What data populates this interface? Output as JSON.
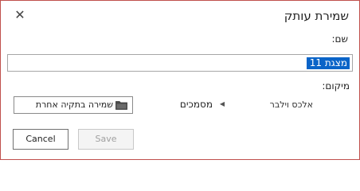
{
  "dialog": {
    "title": "שמירת עותק",
    "close_icon": "close-icon"
  },
  "name": {
    "label": "שם:",
    "value": "מצגת 11"
  },
  "location": {
    "label": "מיקום:",
    "breadcrumb": {
      "user": "אלכס וילבר",
      "separator_icon": "chevron-left-icon",
      "folder": "מסמכים"
    }
  },
  "one_click": {
    "label": "שמירה בתקיה אחרת",
    "icon": "folder-icon"
  },
  "actions": {
    "save_label": "Save",
    "cancel_label": "Cancel"
  }
}
